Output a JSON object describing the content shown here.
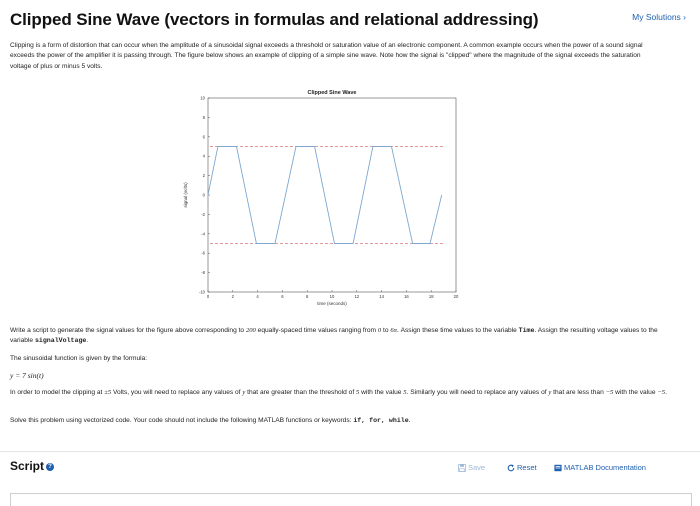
{
  "header": {
    "title": "Clipped Sine Wave (vectors in formulas and relational addressing)",
    "my_solutions": "My Solutions ›"
  },
  "intro": "Clipping is a form of distortion that can occur when the amplitude of a sinusoidal signal exceeds a threshold or saturation value of an electronic component. A common example occurs when the power of a sound signal exceeds the power of the amplifier it is passing through. The figure below shows an example of clipping of a simple sine wave. Note how the signal is \"clipped\" where the magnitude of the signal exceeds the saturation voltage of plus or minus 5 volts.",
  "chart_data": {
    "type": "line",
    "title": "Clipped Sine Wave",
    "xlabel": "time (seconds)",
    "ylabel": "signal (volts)",
    "xlim": [
      0,
      20
    ],
    "ylim": [
      -10,
      10
    ],
    "xticks": [
      "0",
      "2",
      "4",
      "6",
      "8",
      "10",
      "12",
      "14",
      "16",
      "18",
      "20"
    ],
    "yticks": [
      "-10",
      "-8",
      "-6",
      "-4",
      "-2",
      "0",
      "2",
      "4",
      "6",
      "8",
      "10"
    ],
    "series": [
      {
        "values_desc": "7*sin(t) clipped to [-5, 5] for t from 0 to 6π (200 points)",
        "color": "#7fa8d0"
      }
    ],
    "threshold_lines": [
      {
        "y": 5,
        "color": "#e59999"
      },
      {
        "y": -5,
        "color": "#e59999"
      }
    ],
    "x": [
      0,
      0.8,
      2.3,
      3.9,
      5.4,
      7.1,
      8.6,
      10.2,
      11.7,
      13.3,
      14.8,
      16.5,
      17.9,
      18.85
    ],
    "y": [
      0,
      5,
      5,
      -5,
      -5,
      5,
      5,
      -5,
      -5,
      5,
      5,
      -5,
      -5,
      0
    ]
  },
  "task": {
    "p1_a": "Write a script to generate the signal values for the figure above corresponding to ",
    "p1_n": "200",
    "p1_b": " equally-spaced time values ranging from ",
    "p1_r1": "0",
    "p1_c": " to ",
    "p1_r2": "6π",
    "p1_d": ". Assign these time values to the variable ",
    "p1_var1": "Time",
    "p1_e": ". Assign the resulting voltage values to the variable ",
    "p1_var2": "signalVoltage",
    "p1_f": ".",
    "p2": "The sinusoidal function is given by the formula:",
    "formula": "y = 7 sin(t)",
    "p3_a": "In order to model the clipping at ",
    "p3_pm": "±5",
    "p3_b": " Volts, you will need to replace any values of ",
    "p3_y1": "y",
    "p3_c": " that are greater than the threshold of ",
    "p3_5a": "5",
    "p3_d": " with the value ",
    "p3_5b": "5",
    "p3_e": ". Similarly you will need to replace any values of ",
    "p3_y2": "y",
    "p3_f": " that are less than ",
    "p3_m5a": "−5",
    "p3_g": " with the value ",
    "p3_m5b": "−5",
    "p3_h": ".",
    "p4_a": "Solve this problem using vectorized code. Your code should not include the following MATLAB functions or keywords: ",
    "p4_kw": "if, for, while",
    "p4_b": "."
  },
  "script": {
    "title": "Script",
    "help": "?",
    "save": "Save",
    "reset": "Reset",
    "docs": "MATLAB Documentation"
  },
  "colors": {
    "link": "#1f5fae",
    "disabled": "#9fb9d8",
    "signal": "#7fa8d0",
    "threshold": "#e59999"
  }
}
